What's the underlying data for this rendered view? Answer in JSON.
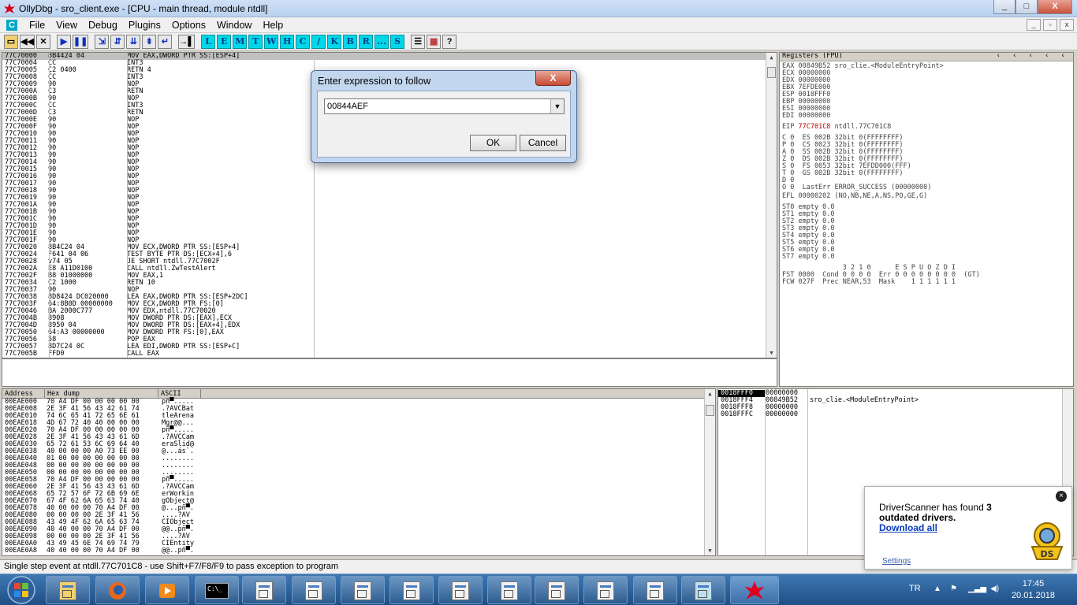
{
  "window": {
    "title": "OllyDbg - sro_client.exe - [CPU - main thread, module ntdll]",
    "min": "_",
    "max": "□",
    "close": "X"
  },
  "menu": {
    "items": [
      "File",
      "View",
      "Debug",
      "Plugins",
      "Options",
      "Window",
      "Help"
    ],
    "mdi_icon": "C"
  },
  "toolbar": {
    "letters": [
      "L",
      "E",
      "M",
      "T",
      "W",
      "H",
      "C",
      "/",
      "K",
      "B",
      "R",
      "...",
      "S"
    ],
    "help": "?"
  },
  "cpu": {
    "rows": [
      [
        "77C70000",
        "8B4424 04",
        "MOV EAX,DWORD PTR SS:[ESP+4]"
      ],
      [
        "77C70004",
        "CC",
        "INT3"
      ],
      [
        "77C70005",
        "C2 0400",
        "RETN 4"
      ],
      [
        "77C70008",
        "CC",
        "INT3"
      ],
      [
        "77C70009",
        "90",
        "NOP"
      ],
      [
        "77C7000A",
        "C3",
        "RETN"
      ],
      [
        "77C7000B",
        "90",
        "NOP"
      ],
      [
        "77C7000C",
        "CC",
        "INT3"
      ],
      [
        "77C7000D",
        "C3",
        "RETN"
      ],
      [
        "77C7000E",
        "90",
        "NOP"
      ],
      [
        "77C7000F",
        "90",
        "NOP"
      ],
      [
        "77C70010",
        "90",
        "NOP"
      ],
      [
        "77C70011",
        "90",
        "NOP"
      ],
      [
        "77C70012",
        "90",
        "NOP"
      ],
      [
        "77C70013",
        "90",
        "NOP"
      ],
      [
        "77C70014",
        "90",
        "NOP"
      ],
      [
        "77C70015",
        "90",
        "NOP"
      ],
      [
        "77C70016",
        "90",
        "NOP"
      ],
      [
        "77C70017",
        "90",
        "NOP"
      ],
      [
        "77C70018",
        "90",
        "NOP"
      ],
      [
        "77C70019",
        "90",
        "NOP"
      ],
      [
        "77C7001A",
        "90",
        "NOP"
      ],
      [
        "77C7001B",
        "90",
        "NOP"
      ],
      [
        "77C7001C",
        "90",
        "NOP"
      ],
      [
        "77C7001D",
        "90",
        "NOP"
      ],
      [
        "77C7001E",
        "90",
        "NOP"
      ],
      [
        "77C7001F",
        "90",
        "NOP"
      ],
      [
        "77C70020",
        "8B4C24 04",
        "MOV ECX,DWORD PTR SS:[ESP+4]"
      ],
      [
        "77C70024",
        "F641 04 06",
        "TEST BYTE PTR DS:[ECX+4],6"
      ],
      [
        "77C70028",
        "v74 05",
        "JE SHORT ntdll.77C7002F"
      ],
      [
        "77C7002A",
        "E8 A11D0100",
        "CALL ntdll.ZwTestAlert"
      ],
      [
        "77C7002F",
        "B8 01000000",
        "MOV EAX,1"
      ],
      [
        "77C70034",
        "C2 1000",
        "RETN 10"
      ],
      [
        "77C70037",
        "90",
        "NOP"
      ],
      [
        "77C70038",
        "8D8424 DC020000",
        "LEA EAX,DWORD PTR SS:[ESP+2DC]"
      ],
      [
        "77C7003F",
        "64:8B0D 00000000",
        "MOV ECX,DWORD PTR FS:[0]"
      ],
      [
        "77C70046",
        "BA 2000C777",
        "MOV EDX,ntdll.77C70020"
      ],
      [
        "77C7004B",
        "8908",
        "MOV DWORD PTR DS:[EAX],ECX"
      ],
      [
        "77C7004D",
        "8950 04",
        "MOV DWORD PTR DS:[EAX+4],EDX"
      ],
      [
        "77C70050",
        "64:A3 00000000",
        "MOV DWORD PTR FS:[0],EAX"
      ],
      [
        "77C70056",
        "58",
        "POP EAX"
      ],
      [
        "77C70057",
        "8D7C24 0C",
        "LEA EDI,DWORD PTR SS:[ESP+C]"
      ],
      [
        "77C7005B",
        "FFD0",
        "CALL EAX"
      ]
    ]
  },
  "registers": {
    "header": "Registers (FPU)",
    "lines": [
      "EAX 00849B52 sro_clie.<ModuleEntryPoint>",
      "ECX 00000000",
      "EDX 00000000",
      "EBX 7EFDE000",
      "ESP 0018FFF0",
      "EBP 00000000",
      "ESI 00000000",
      "EDI 00000000"
    ],
    "eip_label": "EIP",
    "eip_value": "77C701C8",
    "eip_desc": "ntdll.77C701C8",
    "flags": [
      "C 0  ES 002B 32bit 0(FFFFFFFF)",
      "P 0  CS 0023 32bit 0(FFFFFFFF)",
      "A 0  SS 002B 32bit 0(FFFFFFFF)",
      "Z 0  DS 002B 32bit 0(FFFFFFFF)",
      "S 0  FS 0053 32bit 7EFDD000(FFF)",
      "T 0  GS 002B 32bit 0(FFFFFFFF)",
      "D 0",
      "O 0  LastErr ERROR_SUCCESS (00000000)"
    ],
    "efl": "EFL 00000202 (NO,NB,NE,A,NS,PO,GE,G)",
    "fpu": [
      "ST0 empty 0.0",
      "ST1 empty 0.0",
      "ST2 empty 0.0",
      "ST3 empty 0.0",
      "ST4 empty 0.0",
      "ST5 empty 0.0",
      "ST6 empty 0.0",
      "ST7 empty 0.0"
    ],
    "fpu_tail": [
      "               3 2 1 0      E S P U O Z D I",
      "FST 0000  Cond 0 0 0 0  Err 0 0 0 0 0 0 0 0  (GT)",
      "FCW 027F  Prec NEAR,53  Mask    1 1 1 1 1 1"
    ]
  },
  "dump": {
    "headers": [
      "Address",
      "Hex dump",
      "ASCII"
    ],
    "rows": [
      [
        "00EAE000",
        "70 A4 DF 00 00 00 00 00",
        "pñ▀....."
      ],
      [
        "00EAE008",
        "2E 3F 41 56 43 42 61 74",
        ".?AVCBat"
      ],
      [
        "00EAE010",
        "74 6C 65 41 72 65 6E 61",
        "tleArena"
      ],
      [
        "00EAE018",
        "4D 67 72 40 40 00 00 00",
        "Mgr@@..."
      ],
      [
        "00EAE020",
        "70 A4 DF 00 00 00 00 00",
        "pñ▀....."
      ],
      [
        "00EAE028",
        "2E 3F 41 56 43 43 61 6D",
        ".?AVCCam"
      ],
      [
        "00EAE030",
        "65 72 61 53 6C 69 64 40",
        "eraSlid@"
      ],
      [
        "00EAE038",
        "40 00 00 00 A0 73 EE 00",
        "@...ás`."
      ],
      [
        "00EAE040",
        "01 00 00 00 00 00 00 00",
        "........"
      ],
      [
        "00EAE048",
        "00 00 00 00 00 00 00 00",
        "........"
      ],
      [
        "00EAE050",
        "00 00 00 00 00 00 00 00",
        "........"
      ],
      [
        "00EAE058",
        "70 A4 DF 00 00 00 00 00",
        "pñ▀....."
      ],
      [
        "00EAE060",
        "2E 3F 41 56 43 43 61 6D",
        ".?AVCCam"
      ],
      [
        "00EAE068",
        "65 72 57 6F 72 6B 69 6E",
        "erWorkin"
      ],
      [
        "00EAE070",
        "67 4F 62 6A 65 63 74 40",
        "gObject@"
      ],
      [
        "00EAE078",
        "40 00 00 00 70 A4 DF 00",
        "@...pñ▀."
      ],
      [
        "00EAE080",
        "00 00 00 00 2E 3F 41 56",
        "....?AV"
      ],
      [
        "00EAE088",
        "43 49 4F 62 6A 65 63 74",
        "CIObject"
      ],
      [
        "00EAE090",
        "40 40 00 00 70 A4 DF 00",
        "@@..pñ▀."
      ],
      [
        "00EAE098",
        "00 00 00 00 2E 3F 41 56",
        "....?AV"
      ],
      [
        "00EAE0A0",
        "43 49 45 6E 74 69 74 79",
        "CIEntity"
      ],
      [
        "00EAE0A8",
        "40 40 00 00 70 A4 DF 00",
        "@@..pñ▀."
      ]
    ]
  },
  "stack": {
    "rows": [
      [
        "0018FFF0",
        "00000000",
        ""
      ],
      [
        "0018FFF4",
        "00849B52",
        "sro_clie.<ModuleEntryPoint>"
      ],
      [
        "0018FFF8",
        "00000000",
        ""
      ],
      [
        "0018FFFC",
        "00000000",
        ""
      ]
    ]
  },
  "status": "Single step event at ntdll.77C701C8 - use Shift+F7/F8/F9 to pass exception to program",
  "dialog": {
    "title": "Enter expression to follow",
    "close": "X",
    "value": "00844AEF",
    "ok": "OK",
    "cancel": "Cancel"
  },
  "toast": {
    "line1": "DriverScanner has found ",
    "count": "3",
    "line2": "outdated drivers.",
    "link": "Download all",
    "settings": "Settings",
    "close": "×",
    "logo": "DS"
  },
  "taskbar": {
    "lang": "TR",
    "time": "17:45",
    "date": "20.01.2018"
  }
}
